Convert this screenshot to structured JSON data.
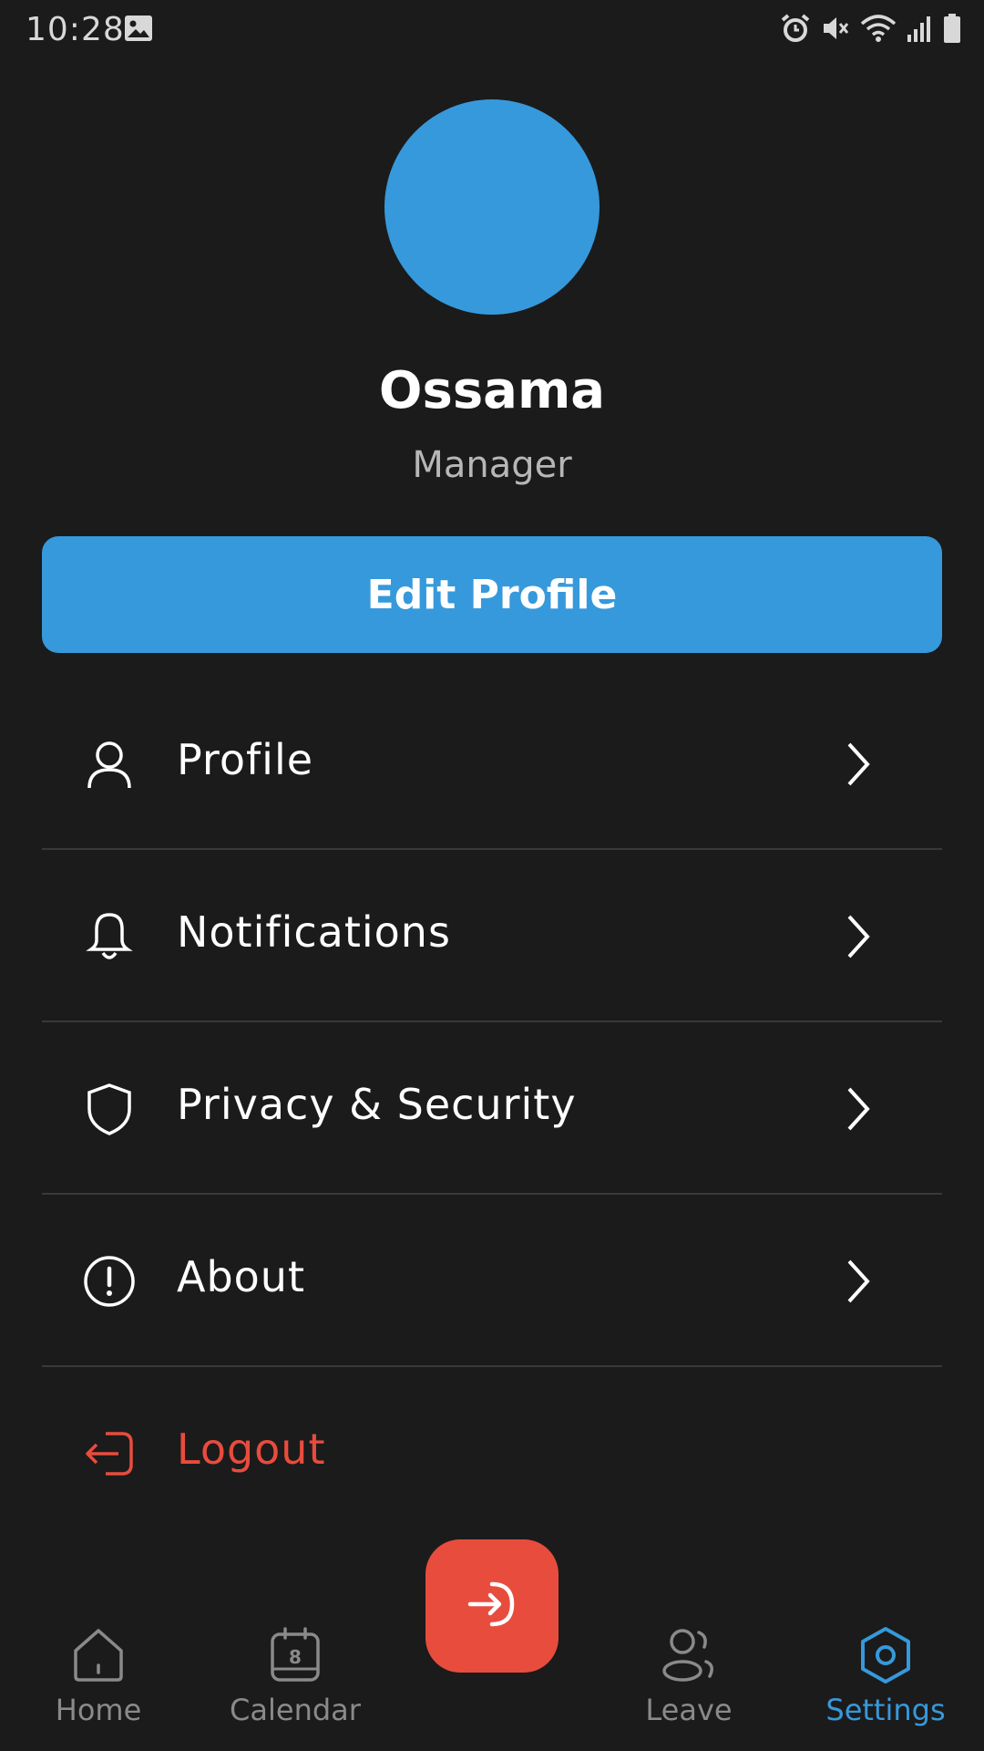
{
  "status_bar": {
    "time": "10:28",
    "icons": [
      "gallery-icon",
      "alarm-icon",
      "mute-icon",
      "wifi-icon",
      "signal-icon",
      "battery-icon"
    ]
  },
  "profile": {
    "name": "Ossama",
    "role": "Manager",
    "avatar_color": "#3699db"
  },
  "edit_profile_label": "Edit Profile",
  "menu": {
    "items": [
      {
        "label": "Profile",
        "icon": "user-icon"
      },
      {
        "label": "Notifications",
        "icon": "bell-icon"
      },
      {
        "label": "Privacy & Security",
        "icon": "shield-icon"
      },
      {
        "label": "About",
        "icon": "info-icon"
      },
      {
        "label": "Logout",
        "icon": "logout-icon"
      }
    ]
  },
  "bottom_nav": {
    "items": [
      {
        "label": "Home",
        "icon": "home-icon"
      },
      {
        "label": "Calendar",
        "icon": "calendar-icon",
        "badge": "8"
      },
      {
        "label": "Leave",
        "icon": "users-icon"
      },
      {
        "label": "Settings",
        "icon": "settings-icon",
        "active": true
      }
    ],
    "fab_icon": "login-arrow-icon"
  },
  "colors": {
    "background": "#1b1b1b",
    "accent": "#3699db",
    "danger": "#e84c3d",
    "muted": "#8a8a8a"
  }
}
